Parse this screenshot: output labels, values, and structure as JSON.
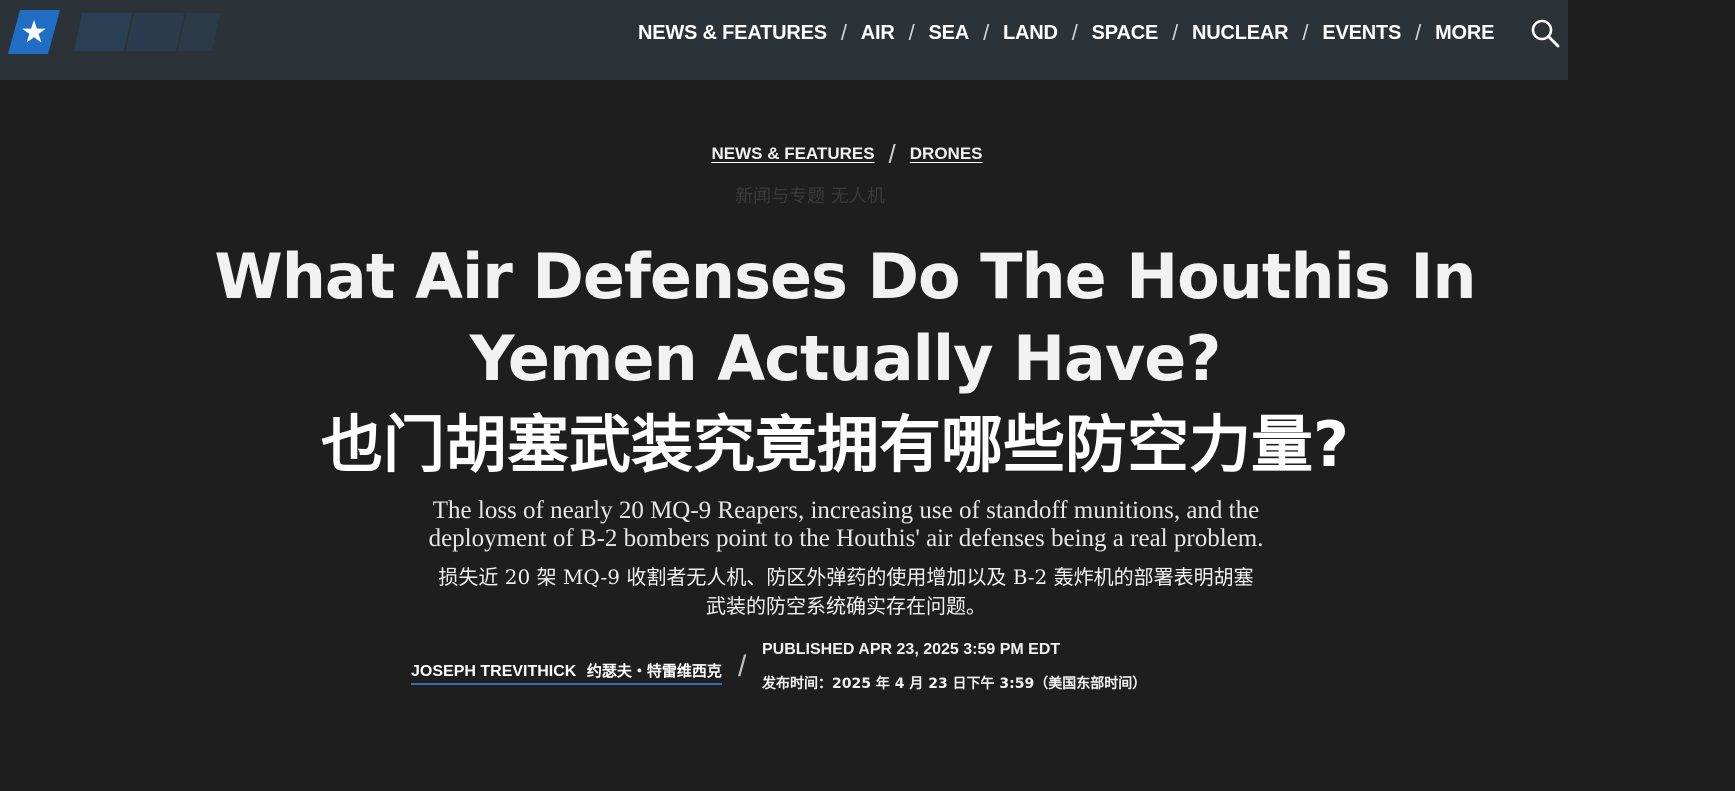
{
  "header": {
    "nav": [
      {
        "label": "NEWS & FEATURES"
      },
      {
        "label": "AIR"
      },
      {
        "label": "SEA"
      },
      {
        "label": "LAND"
      },
      {
        "label": "SPACE"
      },
      {
        "label": "NUCLEAR"
      },
      {
        "label": "EVENTS"
      },
      {
        "label": "MORE"
      }
    ],
    "separator": "/",
    "logo_icon": "star-icon",
    "search_icon": "search-icon"
  },
  "breadcrumb": {
    "items": [
      "NEWS & FEATURES",
      "DRONES"
    ],
    "separator": "/",
    "translation": "新闻与专题 无人机"
  },
  "article": {
    "title_line1": "What Air Defenses Do The Houthis In",
    "title_line2": "Yemen Actually Have?",
    "title_cn": "也门胡塞武装究竟拥有哪些防空力量?",
    "dek_line1": "The loss of nearly 20 MQ-9 Reapers, increasing use of standoff munitions, and the",
    "dek_line2": "deployment of B-2 bombers point to the Houthis' air defenses being a real problem.",
    "dek_cn_line1": "损失近 20 架 MQ-9 收割者无人机、防区外弹药的使用增加以及 B-2 轰炸机的部署表明胡塞",
    "dek_cn_line2": "武装的防空系统确实存在问题。",
    "author": "JOSEPH TREVITHICK",
    "author_cn": "约瑟夫・特雷维西克",
    "byline_separator": "/",
    "published": "PUBLISHED APR 23, 2025 3:59 PM EDT",
    "published_cn": "发布时间：2025 年 4 月 23 日下午 3:59（美国东部时间）"
  },
  "colors": {
    "page_background": "#1e1e1f",
    "topbar_background": "#2c3338",
    "logo_blue": "#1f6ec4",
    "author_underline": "#2f6fb5"
  }
}
